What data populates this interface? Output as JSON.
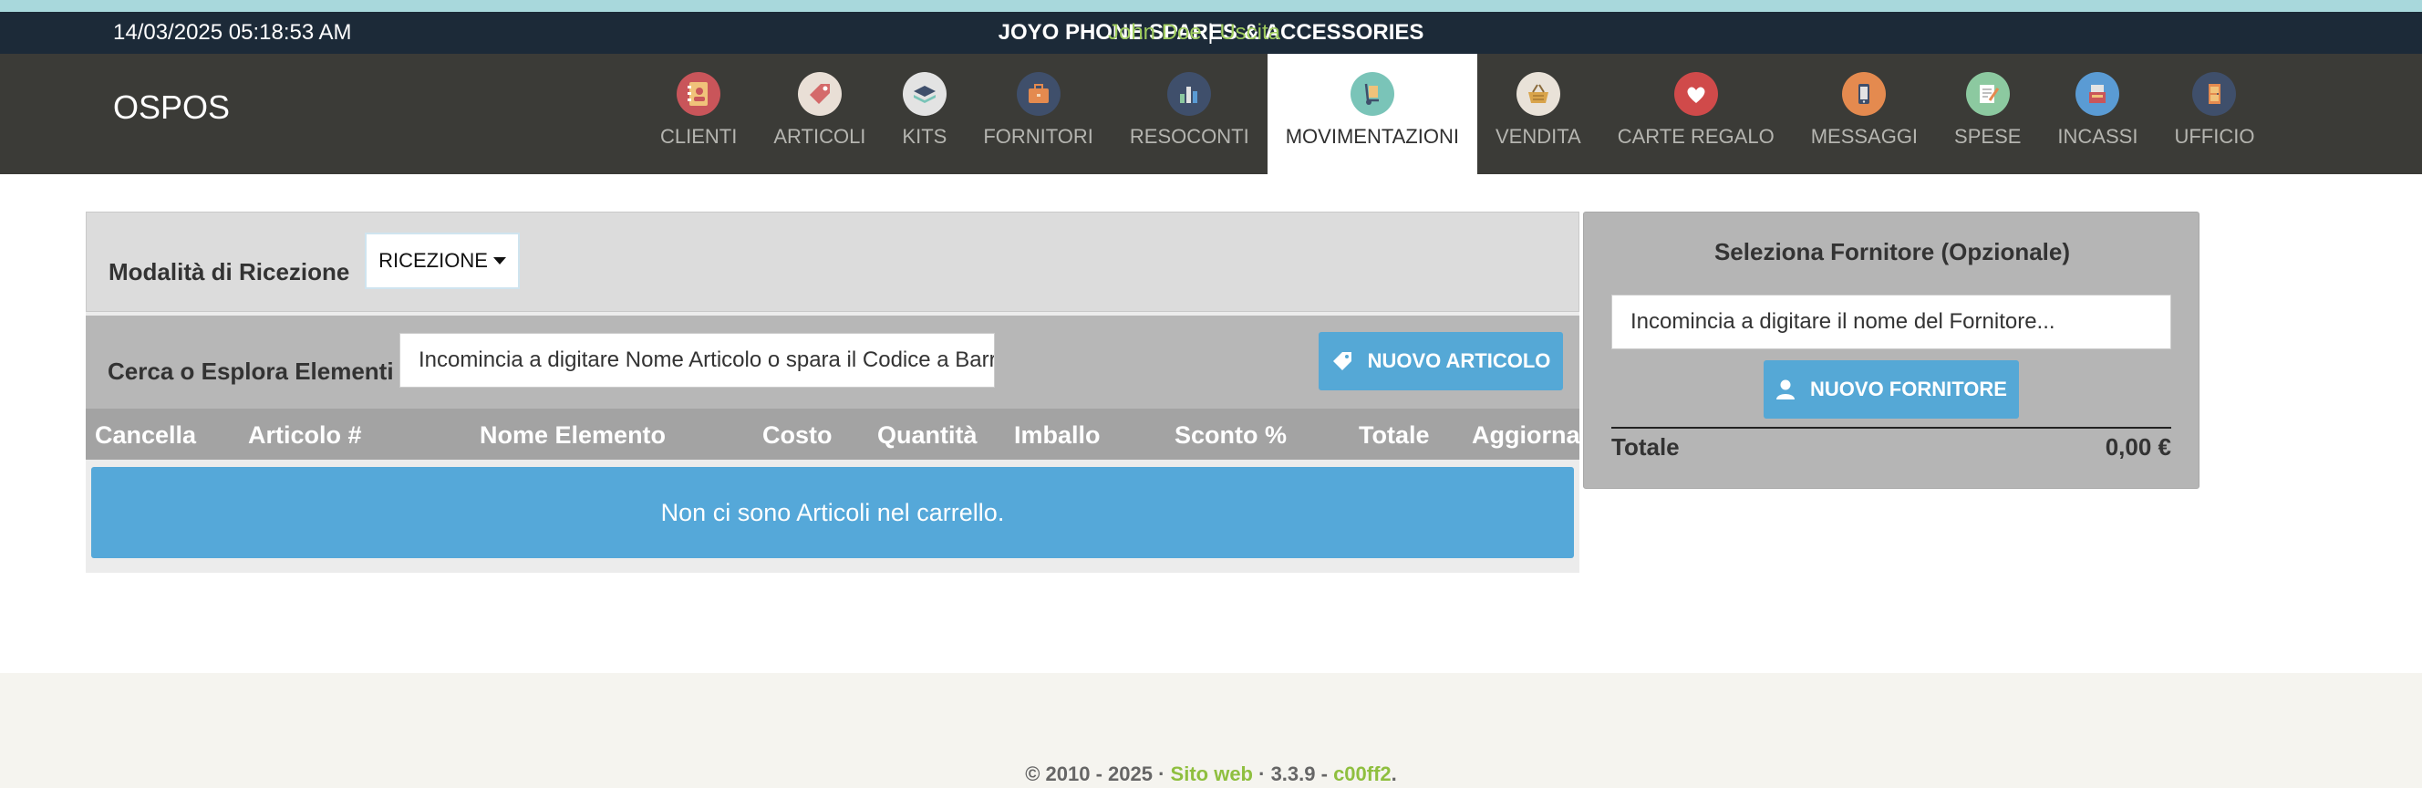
{
  "topbar": {
    "datetime": "14/03/2025 05:18:53 AM",
    "store_name": "JOYO PHONE SPARES & ACCESSORIES",
    "user_name": "John Doe",
    "separator": "|",
    "logout": "Uscita"
  },
  "navbar": {
    "brand": "OSPOS",
    "items": [
      {
        "label": "CLIENTI",
        "icon": "address-book-icon",
        "color": "#c9555a"
      },
      {
        "label": "ARTICOLI",
        "icon": "tag-icon",
        "color": "#e9dfd6"
      },
      {
        "label": "KITS",
        "icon": "layers-icon",
        "color": "#e3e3e3"
      },
      {
        "label": "FORNITORI",
        "icon": "briefcase-icon",
        "color": "#3f4f6b"
      },
      {
        "label": "RESOCONTI",
        "icon": "bar-chart-icon",
        "color": "#3f4f6b"
      },
      {
        "label": "MOVIMENTAZIONI",
        "icon": "hand-truck-icon",
        "color": "#7ac4b8",
        "active": true
      },
      {
        "label": "VENDITA",
        "icon": "shopping-basket-icon",
        "color": "#e9e2d8"
      },
      {
        "label": "CARTE REGALO",
        "icon": "heart-icon",
        "color": "#d04a4a"
      },
      {
        "label": "MESSAGGI",
        "icon": "mobile-phone-icon",
        "color": "#e48a4f"
      },
      {
        "label": "SPESE",
        "icon": "notepad-icon",
        "color": "#8cc9a0"
      },
      {
        "label": "INCASSI",
        "icon": "cash-register-icon",
        "color": "#5a9bd4"
      },
      {
        "label": "UFFICIO",
        "icon": "door-icon",
        "color": "#3f4f6b"
      }
    ]
  },
  "receiving": {
    "mode_label": "Modalità di Ricezione",
    "mode_value": "RICEZIONE",
    "search_label": "Cerca o Esplora Elementi",
    "search_value": "Incomincia a digitare Nome Articolo o spara il Codice a Barre...",
    "new_item_button": "NUOVO ARTICOLO",
    "columns": [
      "Cancella",
      "Articolo #",
      "Nome Elemento",
      "Costo",
      "Quantità",
      "Imballo",
      "Sconto %",
      "Totale",
      "Aggiorna"
    ],
    "empty_message": "Non ci sono Articoli nel carrello."
  },
  "supplier": {
    "title": "Seleziona Fornitore (Opzionale)",
    "input_value": "Incomincia a digitare il nome del Fornitore...",
    "new_supplier_button": "NUOVO FORNITORE",
    "total_label": "Totale",
    "total_value": "0,00 €"
  },
  "footer": {
    "copyright": "© 2010 - 2025 ·",
    "website": "Sito web",
    "version": "· 3.3.9 -",
    "commit": "c00ff2",
    "end": "."
  },
  "colors": {
    "accent_blue": "#55a8d6",
    "link_green": "#9fcc5e",
    "topbar_bg": "#1c2a38",
    "navbar_bg": "#3b3b37"
  }
}
